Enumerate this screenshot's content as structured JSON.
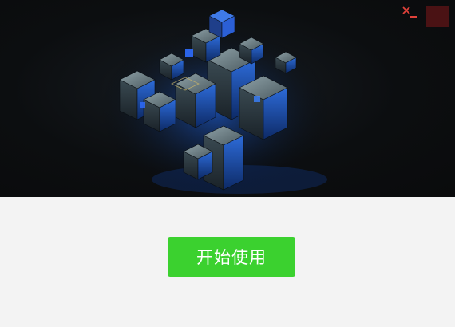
{
  "window": {
    "minimize_icon": "minimize-icon",
    "close_icon": "close-icon"
  },
  "hero": {
    "image": "blue-glowing-cubes-artwork"
  },
  "main": {
    "start_button_label": "开始使用"
  },
  "colors": {
    "accent_green": "#3bd12f",
    "close_bg": "#4a1214",
    "control_red": "#e0413a",
    "background": "#f3f3f3"
  }
}
